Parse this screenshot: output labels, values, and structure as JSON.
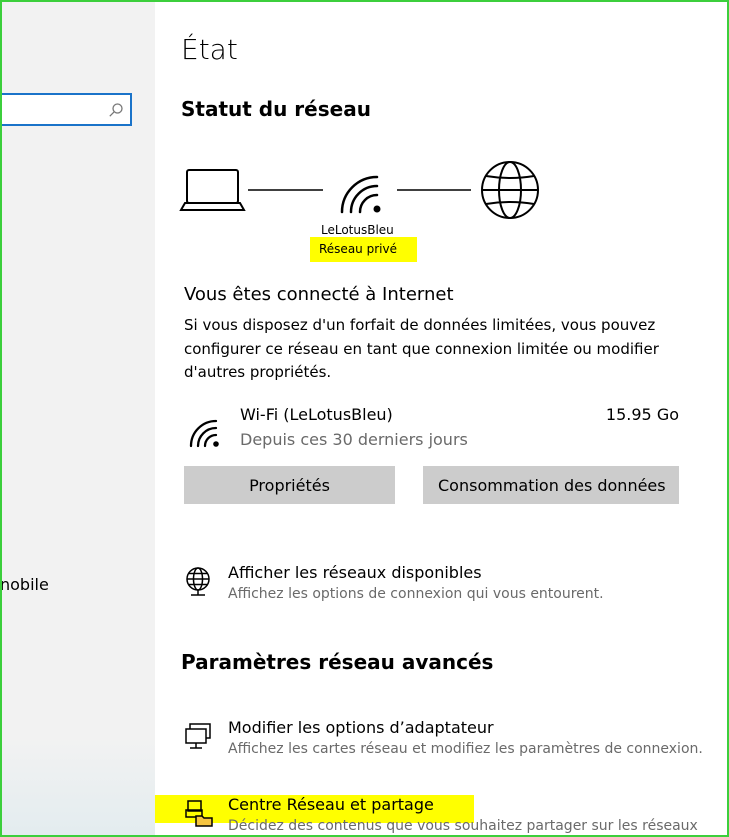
{
  "sidebar": {
    "search": {
      "value": "",
      "icon": "search-icon"
    },
    "visible_item_label": "nobile"
  },
  "page": {
    "title": "État",
    "section_status": "Statut du réseau"
  },
  "network_diagram": {
    "network_name": "LeLotusBleu",
    "network_type": "Réseau privé",
    "icons": [
      "laptop-icon",
      "wifi-icon",
      "globe-icon"
    ]
  },
  "connection": {
    "title": "Vous êtes connecté à Internet",
    "description": "Si vous disposez d'un forfait de données limitées, vous pouvez configurer ce réseau en tant que connexion limitée ou modifier d'autres propriétés.",
    "adapter_name": "Wi-Fi (LeLotusBleu)",
    "usage": "15.95 Go",
    "usage_period": "Depuis ces 30 derniers jours",
    "buttons": {
      "properties": "Propriétés",
      "data_usage": "Consommation des données"
    }
  },
  "links": {
    "show_networks": {
      "title": "Afficher les réseaux disponibles",
      "desc": "Affichez les options de connexion qui vous entourent."
    }
  },
  "advanced": {
    "title": "Paramètres réseau avancés",
    "adapter_options": {
      "title": "Modifier les options d’adaptateur",
      "desc": "Affichez les cartes réseau et modifiez les paramètres de connexion."
    },
    "sharing_center": {
      "title": "Centre Réseau et partage",
      "desc": "Décidez des contenus que vous souhaitez partager sur les réseaux"
    }
  },
  "colors": {
    "highlight": "#ffff00",
    "frame": "#3ccf3c",
    "search_border": "#1a73c9",
    "button_bg": "#cccccc",
    "secondary_text": "#6a6a6a"
  }
}
